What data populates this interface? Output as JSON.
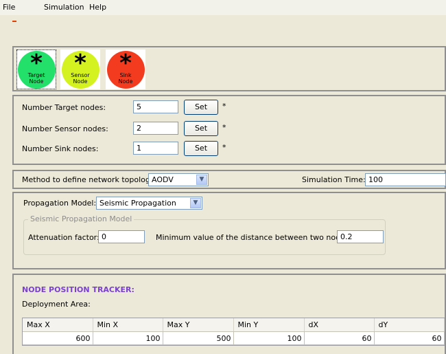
{
  "menu": {
    "file": "File",
    "simulation": "Simulation",
    "help": "Help"
  },
  "nodes": [
    {
      "label_line1": "Target",
      "label_line2": "Node",
      "color": "#22e06a"
    },
    {
      "label_line1": "Sensor",
      "label_line2": "Node",
      "color": "#d4f21f"
    },
    {
      "label_line1": "Sink",
      "label_line2": "Node",
      "color": "#f33c1f"
    }
  ],
  "counts": {
    "target_label": "Number Target nodes:",
    "target_value": "5",
    "sensor_label": "Number Sensor nodes:",
    "sensor_value": "2",
    "sink_label": "Number Sink nodes:",
    "sink_value": "1",
    "set_label": "Set",
    "required_mark": "*"
  },
  "topology": {
    "label": "Method to define network topology:",
    "value": "AODV",
    "sim_time_label": "Simulation Time:",
    "sim_time_value": "100"
  },
  "propagation": {
    "label": "Propagation Model:",
    "value": "Seismic Propagation",
    "group_title": "Seismic Propagation Model",
    "attenuation_label": "Attenuation factor:",
    "attenuation_value": "0",
    "min_distance_label": "Minimum value of the distance between two nodes:",
    "min_distance_value": "0.2"
  },
  "tracker": {
    "title": "NODE POSITION TRACKER:",
    "area_label": "Deployment Area:",
    "columns": [
      "Max X",
      "Min X",
      "Max Y",
      "Min Y",
      "dX",
      "dY"
    ],
    "row": [
      "600",
      "100",
      "500",
      "100",
      "60",
      "60"
    ]
  }
}
